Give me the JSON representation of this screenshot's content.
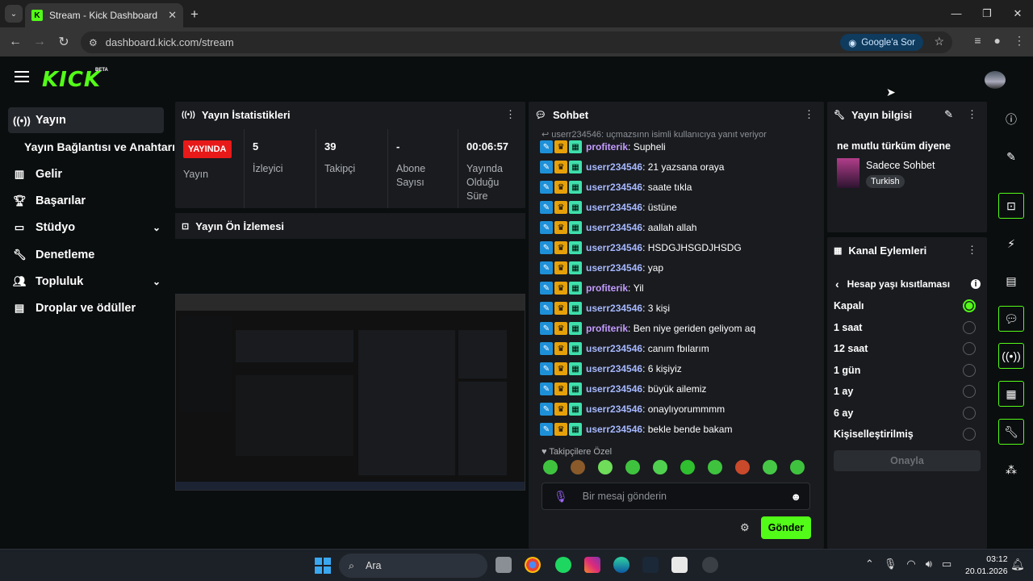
{
  "browser": {
    "tab_title": "Stream - Kick Dashboard",
    "url": "dashboard.kick.com/stream",
    "ask_label": "Google'a Sor"
  },
  "app": {
    "logo": "KICK",
    "beta": "BETA"
  },
  "sidebar": {
    "items": [
      {
        "label": "Yayın",
        "icon": "broadcast-icon"
      },
      {
        "label": "Yayın Bağlantısı ve Anahtarı",
        "icon": ""
      },
      {
        "label": "Gelir",
        "icon": "chart-icon"
      },
      {
        "label": "Başarılar",
        "icon": "trophy-icon"
      },
      {
        "label": "Stüdyo",
        "icon": "studio-icon"
      },
      {
        "label": "Denetleme",
        "icon": "wrench-icon"
      },
      {
        "label": "Topluluk",
        "icon": "people-icon"
      },
      {
        "label": "Droplar ve ödüller",
        "icon": "gift-icon"
      }
    ]
  },
  "stats": {
    "title": "Yayın İstatistikleri",
    "live_badge": "YAYINDA",
    "live_label": "Yayın",
    "viewers_value": "5",
    "viewers_label": "İzleyici",
    "followers_value": "39",
    "followers_label": "Takipçi",
    "subs_value": "-",
    "subs_label": "Abone Sayısı",
    "uptime_value": "00:06:57",
    "uptime_label": "Yayında Olduğu Süre"
  },
  "preview": {
    "title": "Yayın Ön İzlemesi"
  },
  "chat": {
    "title": "Sohbet",
    "reply_hint": "userr234546: uçmazsınn isimli kullanıcıya yanıt veriyor",
    "messages": [
      {
        "user": "profiterik",
        "text": "Supheli",
        "color": "#c49cff"
      },
      {
        "user": "userr234546",
        "text": "21 yazsana oraya",
        "color": "#a6b8ff"
      },
      {
        "user": "userr234546",
        "text": "saate tıkla",
        "color": "#a6b8ff"
      },
      {
        "user": "userr234546",
        "text": "üstüne",
        "color": "#a6b8ff"
      },
      {
        "user": "userr234546",
        "text": "aallah allah",
        "color": "#a6b8ff"
      },
      {
        "user": "userr234546",
        "text": "HSDGJHSGDJHSDG",
        "color": "#a6b8ff"
      },
      {
        "user": "userr234546",
        "text": "yap",
        "color": "#a6b8ff"
      },
      {
        "user": "profiterik",
        "text": "Yil",
        "color": "#c49cff"
      },
      {
        "user": "userr234546",
        "text": "3 kişi",
        "color": "#a6b8ff"
      },
      {
        "user": "profiterik",
        "text": "Ben niye geriden geliyom aq",
        "color": "#c49cff"
      },
      {
        "user": "userr234546",
        "text": "canım fbılarım",
        "color": "#a6b8ff"
      },
      {
        "user": "userr234546",
        "text": "6 kişiyiz",
        "color": "#a6b8ff"
      },
      {
        "user": "userr234546",
        "text": "büyük ailemiz",
        "color": "#a6b8ff"
      },
      {
        "user": "userr234546",
        "text": "onaylıyorummmm",
        "color": "#a6b8ff"
      },
      {
        "user": "userr234546",
        "text": "bekle bende bakam",
        "color": "#a6b8ff"
      }
    ],
    "followers_only": "Takipçilere Özel",
    "placeholder": "Bir mesaj gönderin",
    "send_label": "Gönder"
  },
  "info": {
    "title": "Yayın bilgisi",
    "stream_title": "ne mutlu türküm diyene",
    "category": "Sadece Sohbet",
    "language": "Turkish"
  },
  "actions": {
    "title": "Kanal Eylemleri",
    "subtitle": "Hesap yaşı kısıtlaması",
    "options": [
      "Kapalı",
      "1 saat",
      "12 saat",
      "1 gün",
      "1 ay",
      "6 ay",
      "Kişiselleştirilmiş"
    ],
    "selected": "Kapalı",
    "confirm_label": "Onayla"
  },
  "taskbar": {
    "search_label": "Ara",
    "time": "03:12",
    "date": "20.01.2026"
  },
  "colors": {
    "accent": "#53fc18",
    "live": "#e81919"
  }
}
